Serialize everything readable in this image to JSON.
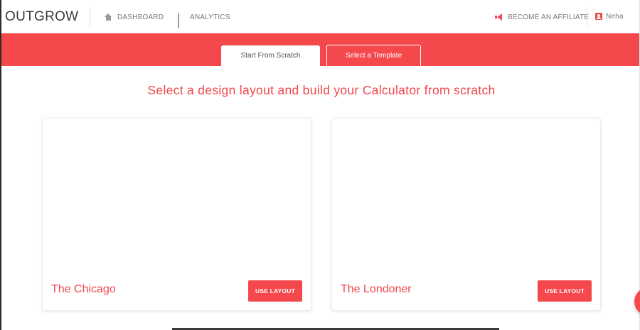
{
  "brand": {
    "name": "OUTGROW"
  },
  "nav": {
    "dashboard": {
      "label": "DASHBOARD",
      "icon": "home-icon"
    },
    "analytics": {
      "label": "ANALYTICS",
      "icon": "bar-chart-icon"
    },
    "affiliate": {
      "label": "BECOME AN AFFILIATE",
      "icon": "megaphone-icon"
    },
    "user": {
      "label": "Neha",
      "icon": "user-icon"
    }
  },
  "tabs": [
    {
      "label": "Start From Scratch",
      "active": true
    },
    {
      "label": "Select a Template",
      "active": false
    }
  ],
  "heading": "Select a design layout and build your Calculator from scratch",
  "cards": [
    {
      "title": "The Chicago",
      "button": "USE LAYOUT"
    },
    {
      "title": "The Londoner",
      "button": "USE LAYOUT"
    }
  ],
  "colors": {
    "accent": "#f4484d",
    "text": "#3a3a3a"
  }
}
